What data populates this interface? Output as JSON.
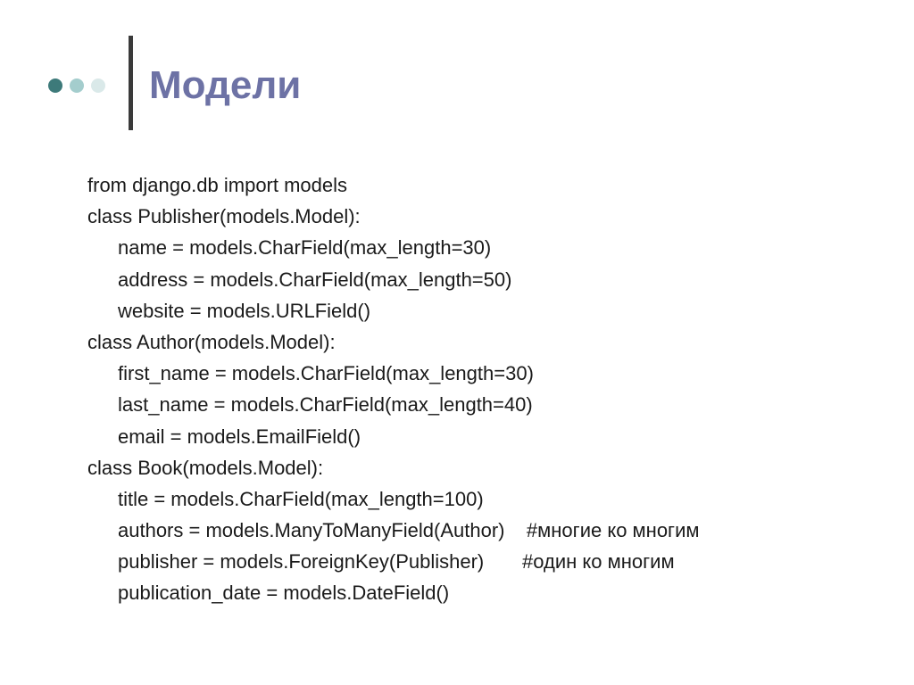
{
  "slide": {
    "title": "Модели"
  },
  "code": {
    "lines": [
      {
        "text": "from django.db import models",
        "indent": false
      },
      {
        "text": "class Publisher(models.Model):",
        "indent": false
      },
      {
        "text": "name = models.CharField(max_length=30)",
        "indent": true
      },
      {
        "text": "address = models.CharField(max_length=50)",
        "indent": true
      },
      {
        "text": "website = models.URLField()",
        "indent": true
      },
      {
        "text": "class Author(models.Model):",
        "indent": false
      },
      {
        "text": "first_name = models.CharField(max_length=30)",
        "indent": true
      },
      {
        "text": "last_name = models.CharField(max_length=40)",
        "indent": true
      },
      {
        "text": "email = models.EmailField()",
        "indent": true
      },
      {
        "text": "class Book(models.Model):",
        "indent": false
      },
      {
        "text": "title = models.CharField(max_length=100)",
        "indent": true
      },
      {
        "text": "authors = models.ManyToManyField(Author)    #многие ко многим",
        "indent": true
      },
      {
        "text": "publisher = models.ForeignKey(Publisher)       #один ко многим",
        "indent": true
      },
      {
        "text": "publication_date = models.DateField()",
        "indent": true
      }
    ]
  },
  "colors": {
    "title": "#6d72a5",
    "dot_dark": "#3d7a7a",
    "dot_mid": "#a4cdcd",
    "dot_light": "#dae9e9",
    "rule": "#3a3a3a",
    "body_text": "#1a1a1a"
  }
}
